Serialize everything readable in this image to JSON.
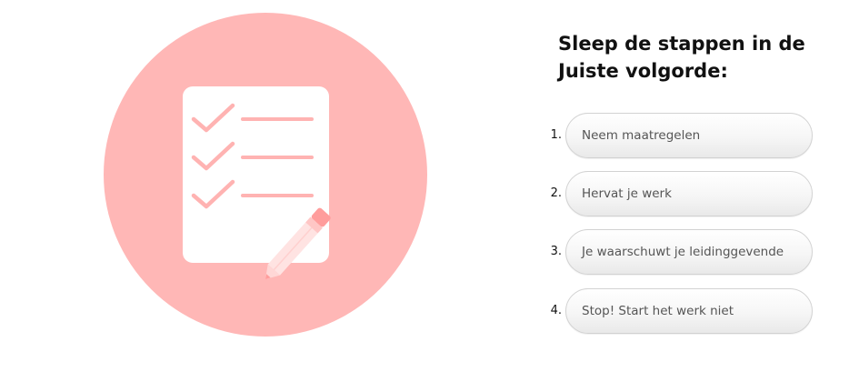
{
  "colors": {
    "circle": "#ffb7b6",
    "accent": "#ff9d9c",
    "paper": "#ffffff",
    "text": "#111111",
    "step_text": "#555555"
  },
  "illustration": {
    "icon": "checklist-pencil-icon"
  },
  "title": "Sleep de stappen in de Juiste volgorde:",
  "steps": [
    {
      "number": "1.",
      "label": "Neem maatregelen"
    },
    {
      "number": "2.",
      "label": "Hervat je werk"
    },
    {
      "number": "3.",
      "label": "Je waarschuwt je leidinggevende"
    },
    {
      "number": "4.",
      "label": "Stop! Start het werk niet"
    }
  ]
}
